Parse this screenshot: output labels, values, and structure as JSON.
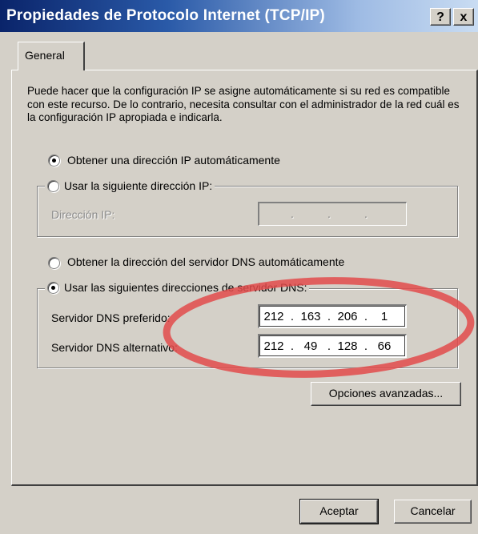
{
  "window": {
    "title": "Propiedades de Protocolo Internet (TCP/IP)",
    "help_label": "?",
    "close_label": "x"
  },
  "tabs": [
    {
      "label": "General"
    }
  ],
  "intro_text": "Puede hacer que la configuración IP se asigne automáticamente si su red es compatible con este recurso. De lo contrario, necesita consultar con el administrador de la red cuál es la configuración IP apropiada e indicarla.",
  "ip": {
    "auto_label": "Obtener una dirección IP automáticamente",
    "auto_selected": true,
    "manual_label": "Usar la siguiente dirección IP:",
    "manual_selected": false,
    "address_label": "Dirección IP:",
    "address_value": [
      "",
      "",
      "",
      ""
    ]
  },
  "dns": {
    "auto_label": "Obtener la dirección del servidor DNS automáticamente",
    "auto_selected": false,
    "manual_label": "Usar las siguientes direcciones de servidor DNS:",
    "manual_selected": true,
    "preferred_label": "Servidor DNS preferido:",
    "preferred_octets": [
      "212",
      "163",
      "206",
      "1"
    ],
    "alternate_label": "Servidor DNS alternativo:",
    "alternate_octets": [
      "212",
      "49",
      "128",
      "66"
    ]
  },
  "buttons": {
    "advanced": "Opciones avanzadas...",
    "ok": "Aceptar",
    "cancel": "Cancelar"
  },
  "colors": {
    "title_start": "#0a246a",
    "title_end": "#c9dcf2",
    "face": "#d4d0c8",
    "annotation": "#e24b4b"
  }
}
